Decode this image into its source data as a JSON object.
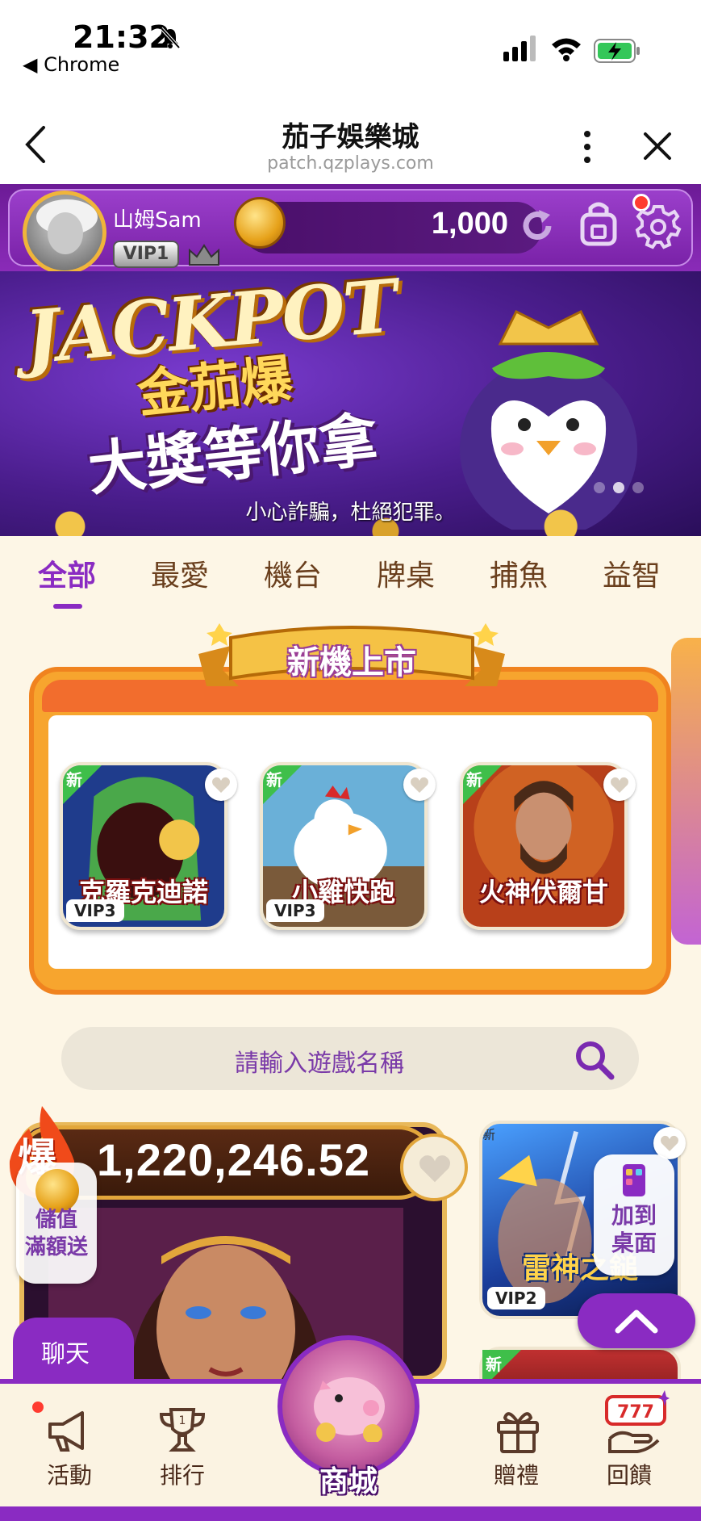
{
  "status": {
    "time": "21:32",
    "back_app": "◀ Chrome"
  },
  "browser": {
    "title": "茄子娛樂城",
    "url": "patch.qzplays.com"
  },
  "user": {
    "name": "山姆Sam",
    "vip": "VIP1",
    "coins": "1,000"
  },
  "banner": {
    "headline": "JACKPOT",
    "line1": "金茄爆",
    "line2": "大獎等你拿",
    "note": "小心詐騙，杜絕犯罪。",
    "slide_index": 2,
    "slide_count": 3
  },
  "categories": [
    {
      "label": "全部",
      "active": true
    },
    {
      "label": "最愛"
    },
    {
      "label": "機台"
    },
    {
      "label": "牌桌"
    },
    {
      "label": "捕魚"
    },
    {
      "label": "益智"
    }
  ],
  "new_games": {
    "ribbon": "新機上市",
    "tiles": [
      {
        "title": "克羅克迪諾",
        "tag": "新",
        "vip": "VIP3"
      },
      {
        "title": "小雞快跑",
        "tag": "新",
        "vip": "VIP3"
      },
      {
        "title": "火神伏爾甘",
        "tag": "新",
        "vip": ""
      }
    ]
  },
  "search": {
    "placeholder": "請輸入遊戲名稱"
  },
  "jackpot_card": {
    "hot_label": "爆",
    "value": "1,220,246.52"
  },
  "topup": {
    "line1": "儲值",
    "line2": "滿額送"
  },
  "side_game": {
    "tag": "新",
    "title": "雷神之鎚",
    "vip": "VIP2"
  },
  "add_home": {
    "line1": "加到",
    "line2": "桌面"
  },
  "side_game_2": {
    "tag": "新"
  },
  "chat": {
    "label": "聊天"
  },
  "nav": {
    "activity": "活動",
    "rank": "排行",
    "shop": "商城",
    "gift": "贈禮",
    "rebate": "回饋"
  },
  "colors": {
    "accent": "#8a2bc2",
    "orange": "#f26d2d",
    "gold": "#e2a63b",
    "bg": "#fdf6e6"
  }
}
